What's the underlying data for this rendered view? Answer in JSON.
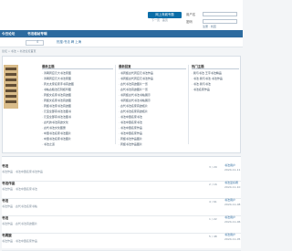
{
  "header": {
    "badge_label": "网上商城专题",
    "badge_sub": "下一页 · 首页",
    "username_label": "用户名",
    "password_label": "密码",
    "footer_links": "注册 · 找回"
  },
  "nav": {
    "items": [
      "今日论坛",
      "书法临帖专辑"
    ]
  },
  "search": {
    "hot_text": "热搜:书法 碑 上海"
  },
  "breadcrumb": "论坛 » 书法 » 书法论坛首页",
  "panel": {
    "columns": [
      "最新主题",
      "最新回复",
      "热门主题"
    ],
    "col1": [
      "· 清朝周应元大书法家图",
      "· 清朝周应元大书法家图",
      "· 周太太家名家手书真迹图",
      "· 书帖古籍法石刻拓印图",
      "· 周旋文名家书法真迹图",
      "· 周旋文名家书法真迹图",
      "· 周旋书法家书法真迹图",
      "· 元宝全部真书法法图书",
      "· 元宝全部真书法法图书",
      "· 古代的书法真迹文化",
      "· 古代书法文化图册",
      "· 中国书法名家书法图片",
      "· 中国书法名家书法图片",
      "· 书法之道"
    ],
    "col2": [
      "· 书周旋古代周应元书法作品",
      "· 书周旋古代周应元书法作品",
      "· 古代书法真迹图片一览",
      "· 古代书法真迹图片一览",
      "· 书周旋古代书法书帖展示",
      "· 书周旋古代书法书帖展示",
      "· 古代书法名家真迹拓片",
      "· 古代书法名家真迹拓片",
      "· 书法中国名家书法",
      "· 书法中国名家书法",
      "· 书法中国名家作品",
      "· 书法中国名家作品",
      "· 周旋书法作品图片",
      "· 周旋书法作品图片"
    ],
    "col3": [
      "· 我与书法·王字书法精品",
      "· 书法·我与书法·书法作品",
      "· 书法·我与书法",
      "· 书法名家作品"
    ]
  },
  "list": {
    "heading": "版块主题",
    "posts": [
      {
        "title": "书法",
        "sub": "书法作品 · 书法中国名家书法作品",
        "stats": "3 / 29",
        "user": "书法用户",
        "date": "2024-11-11"
      },
      {
        "title": "书法作品",
        "sub": "书法作品 · 书法中国名家书法",
        "stats": "2 / 16",
        "user": "书法爱好者",
        "date": "2024-11-10"
      },
      {
        "title": "书法",
        "sub": "书法作品 · 古代书法名家书帖",
        "stats": "4 / 61",
        "user": "书法用户",
        "date": "2024-11-08"
      },
      {
        "title": "书法",
        "sub": "书法作品 · 古代书法真迹图片",
        "stats": "1 / 22",
        "user": "书法用户",
        "date": "2024-11-06"
      },
      {
        "title": "书周旋",
        "sub": "书法作品 · 书法中国名家作品",
        "stats": "5 / 48",
        "user": "书法用户",
        "date": "2024-11-05"
      }
    ]
  }
}
